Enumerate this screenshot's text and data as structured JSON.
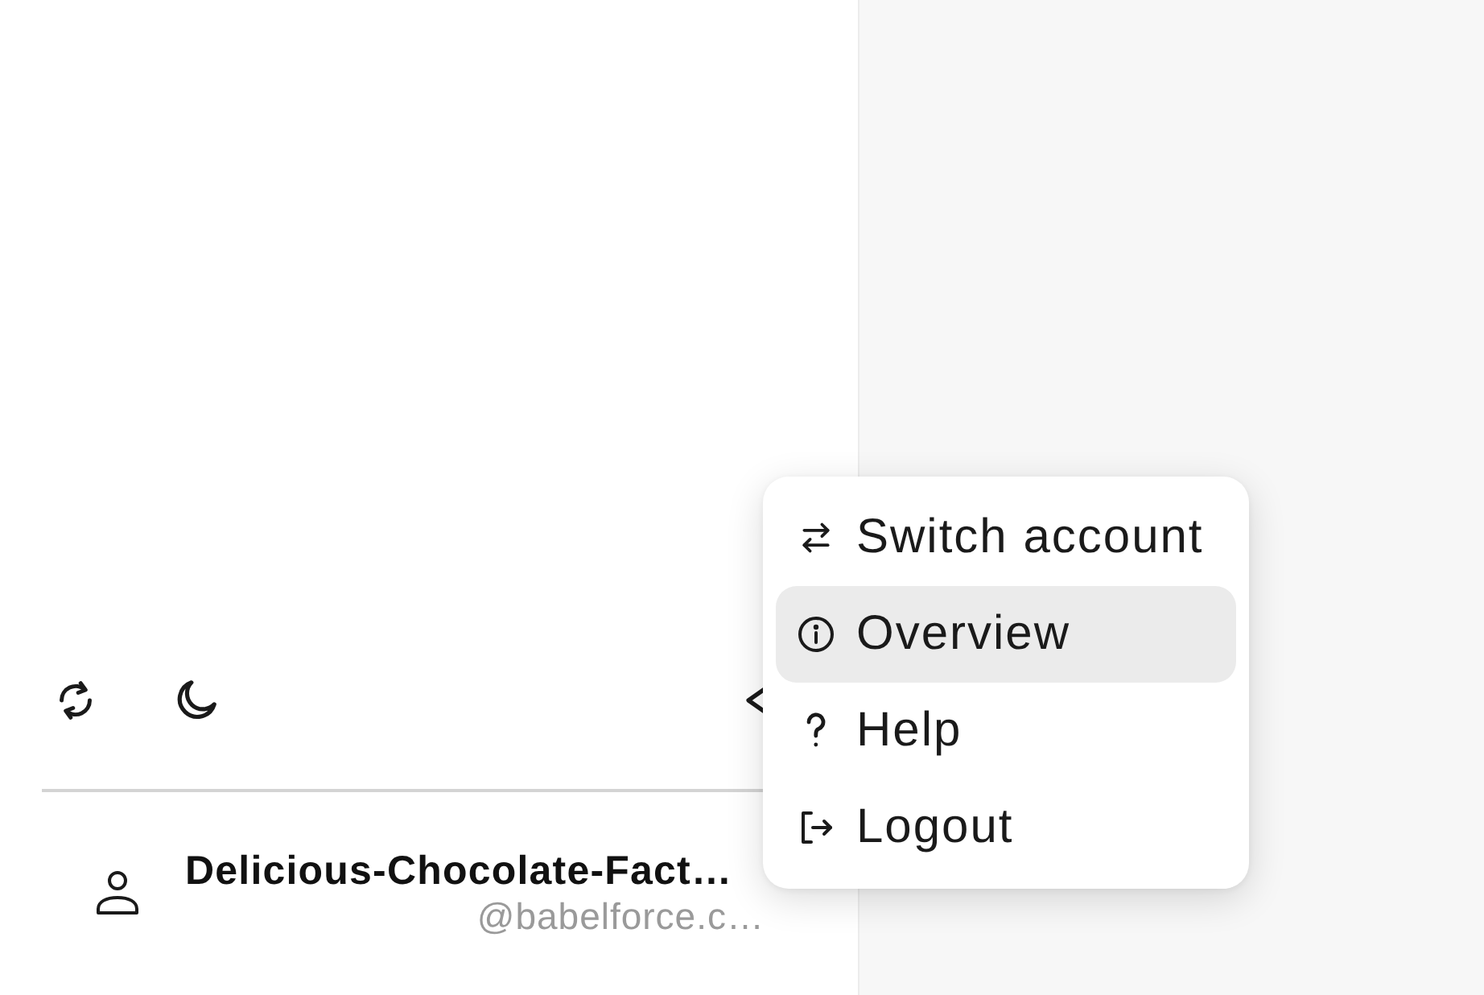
{
  "sidebar": {
    "account": {
      "name": "Delicious-Chocolate-Fact…",
      "handle": "@babelforce.c…"
    }
  },
  "menu": {
    "items": [
      {
        "kind": "switch",
        "label": "Switch account",
        "selected": false
      },
      {
        "kind": "info",
        "label": "Overview",
        "selected": true
      },
      {
        "kind": "help",
        "label": "Help",
        "selected": false
      },
      {
        "kind": "logout",
        "label": "Logout",
        "selected": false
      }
    ]
  }
}
